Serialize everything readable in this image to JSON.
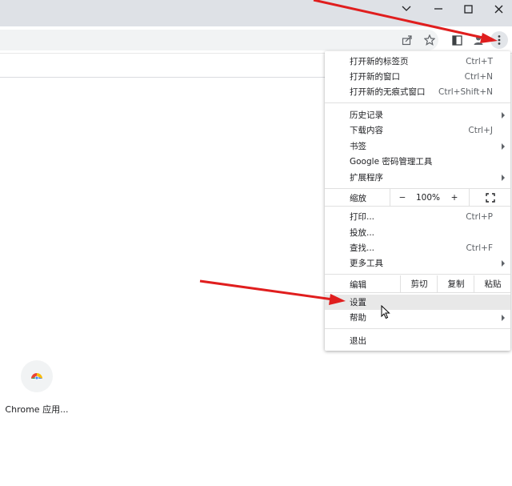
{
  "window_controls": {
    "chevron": "chevron-down-icon",
    "minimize": "minimize-icon",
    "maximize": "maximize-icon",
    "close": "close-icon"
  },
  "toolbar": {
    "share": "share-icon",
    "bookmark": "star-icon",
    "sidepanel": "side-panel-icon",
    "profile": "profile-icon",
    "menu": "kebab-menu-icon"
  },
  "menu": {
    "new_tab": {
      "label": "打开新的标签页",
      "shortcut": "Ctrl+T"
    },
    "new_window": {
      "label": "打开新的窗口",
      "shortcut": "Ctrl+N"
    },
    "incognito": {
      "label": "打开新的无痕式窗口",
      "shortcut": "Ctrl+Shift+N"
    },
    "history": {
      "label": "历史记录"
    },
    "downloads": {
      "label": "下载内容",
      "shortcut": "Ctrl+J"
    },
    "bookmarks": {
      "label": "书签"
    },
    "passwords": {
      "label": "Google 密码管理工具"
    },
    "extensions": {
      "label": "扩展程序"
    },
    "zoom": {
      "label": "缩放",
      "minus": "−",
      "value": "100%",
      "plus": "+"
    },
    "print": {
      "label": "打印...",
      "shortcut": "Ctrl+P"
    },
    "cast": {
      "label": "投放..."
    },
    "find": {
      "label": "查找...",
      "shortcut": "Ctrl+F"
    },
    "more_tools": {
      "label": "更多工具"
    },
    "edit": {
      "label": "编辑",
      "cut": "剪切",
      "copy": "复制",
      "paste": "粘贴"
    },
    "settings": {
      "label": "设置"
    },
    "help": {
      "label": "帮助"
    },
    "exit": {
      "label": "退出"
    }
  },
  "shortcut_app": {
    "label": "Chrome 应用..."
  },
  "colors": {
    "annotation_arrow": "#e01e1e",
    "titlebar": "#dee1e6",
    "hover": "#e8e8e8"
  }
}
